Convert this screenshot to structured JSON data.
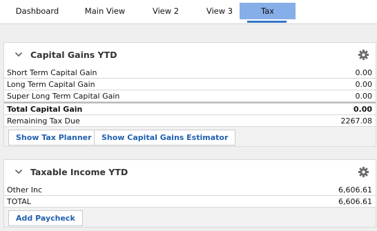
{
  "tabs": [
    {
      "label": "Dashboard"
    },
    {
      "label": "Main View"
    },
    {
      "label": "View 2"
    },
    {
      "label": "View 3"
    },
    {
      "label": "Tax",
      "active": true
    }
  ],
  "capital_gains": {
    "title": "Capital Gains YTD",
    "rows": [
      {
        "label": "Short Term Capital Gain",
        "value": "0.00"
      },
      {
        "label": "Long Term Capital Gain",
        "value": "0.00"
      },
      {
        "label": "Super Long Term Capital Gain",
        "value": "0.00"
      }
    ],
    "total": {
      "label": "Total Capital Gain",
      "value": "0.00"
    },
    "remaining": {
      "label": "Remaining Tax Due",
      "value": "2267.08"
    },
    "buttons": {
      "tax_planner": "Show Tax Planner",
      "gains_estimator": "Show Capital Gains Estimator"
    }
  },
  "taxable_income": {
    "title": "Taxable Income YTD",
    "rows": [
      {
        "label": "Other Inc",
        "value": "6,606.61"
      },
      {
        "label": "TOTAL",
        "value": "6,606.61"
      }
    ],
    "buttons": {
      "add_paycheck": "Add Paycheck"
    }
  },
  "colors": {
    "active_tab_bg": "#86aee8",
    "active_tab_underline": "#2f74c8",
    "button_text": "#1f5fae"
  },
  "icons": [
    "chevron-down-icon",
    "gear-icon"
  ]
}
